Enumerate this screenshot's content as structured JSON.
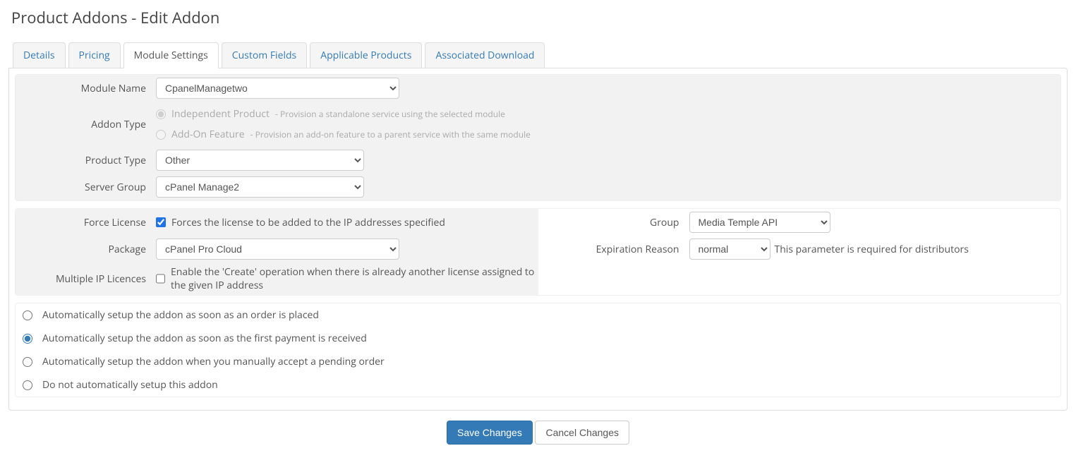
{
  "page": {
    "title": "Product Addons - Edit Addon"
  },
  "tabs": {
    "details": "Details",
    "pricing": "Pricing",
    "module_settings": "Module Settings",
    "custom_fields": "Custom Fields",
    "applicable_products": "Applicable Products",
    "associated_download": "Associated Download"
  },
  "labels": {
    "module_name": "Module Name",
    "addon_type": "Addon Type",
    "product_type": "Product Type",
    "server_group": "Server Group",
    "force_license": "Force License",
    "package": "Package",
    "multiple_ip": "Multiple IP Licences",
    "group": "Group",
    "expiration_reason": "Expiration Reason"
  },
  "values": {
    "module_name": "CpanelManagetwo",
    "product_type": "Other",
    "server_group": "cPanel Manage2",
    "package": "cPanel Pro Cloud",
    "group": "Media Temple API",
    "expiration_reason": "normal"
  },
  "addon_type": {
    "independent_title": "Independent Product",
    "independent_desc": "- Provision a standalone service using the selected module",
    "addon_feature_title": "Add-On Feature",
    "addon_feature_desc": "- Provision an add-on feature to a parent service with the same module"
  },
  "help": {
    "force_license": "Forces the license to be added to the IP addresses specified",
    "multiple_ip": "Enable the 'Create' operation when there is already another license assigned to the given IP address",
    "expiration_reason": "This parameter is required for distributors"
  },
  "auto_setup": {
    "opt1": "Automatically setup the addon as soon as an order is placed",
    "opt2": "Automatically setup the addon as soon as the first payment is received",
    "opt3": "Automatically setup the addon when you manually accept a pending order",
    "opt4": "Do not automatically setup this addon"
  },
  "buttons": {
    "save": "Save Changes",
    "cancel": "Cancel Changes"
  }
}
